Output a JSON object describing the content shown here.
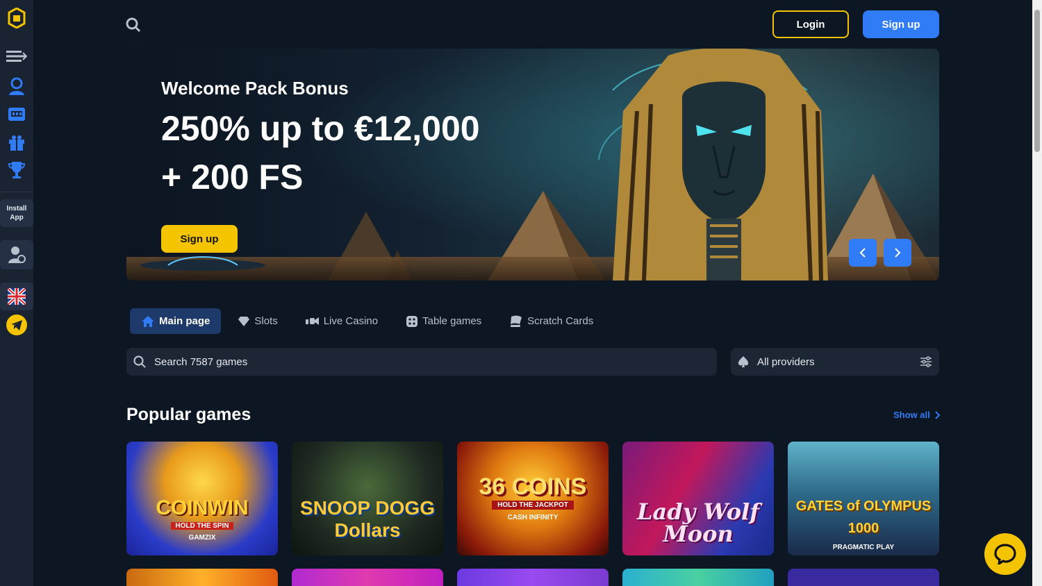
{
  "header": {
    "login_label": "Login",
    "signup_label": "Sign up"
  },
  "sidebar": {
    "install_line1": "Install",
    "install_line2": "App",
    "icons": [
      "logo-icon",
      "menu-expand-icon",
      "user-support-icon",
      "slot-machine-icon",
      "gift-icon",
      "trophy-icon",
      "support-chat-icon",
      "uk-flag-icon",
      "telegram-icon"
    ]
  },
  "hero": {
    "subtitle": "Welcome Pack Bonus",
    "title_line1": "250% up to €12,000",
    "title_line2": "+ 200 FS",
    "signup_label": "Sign up"
  },
  "tabs": [
    {
      "label": "Main page",
      "active": true
    },
    {
      "label": "Slots"
    },
    {
      "label": "Live Casino"
    },
    {
      "label": "Table games"
    },
    {
      "label": "Scratch Cards"
    }
  ],
  "search": {
    "placeholder": "Search 7587 games"
  },
  "providers": {
    "label": "All providers"
  },
  "popular": {
    "title": "Popular games",
    "show_all": "Show all",
    "games": [
      {
        "title": "COINWIN",
        "tagline": "HOLD THE SPIN",
        "provider": "GAMZIX"
      },
      {
        "title": "SNOOP DOGG Dollars",
        "tagline": "",
        "provider": ""
      },
      {
        "title": "36 COINS",
        "tagline": "HOLD THE JACKPOT",
        "provider": "CASH INFINITY"
      },
      {
        "title": "Lady Wolf Moon",
        "tagline": "",
        "provider": ""
      },
      {
        "title": "GATES of OLYMPUS 1000",
        "tagline": "",
        "provider": "PRAGMATIC PLAY"
      }
    ]
  },
  "colors": {
    "background": "#0d1623",
    "sidebar": "#1a2332",
    "accent_yellow": "#f5c400",
    "accent_blue": "#2f7cf6"
  }
}
